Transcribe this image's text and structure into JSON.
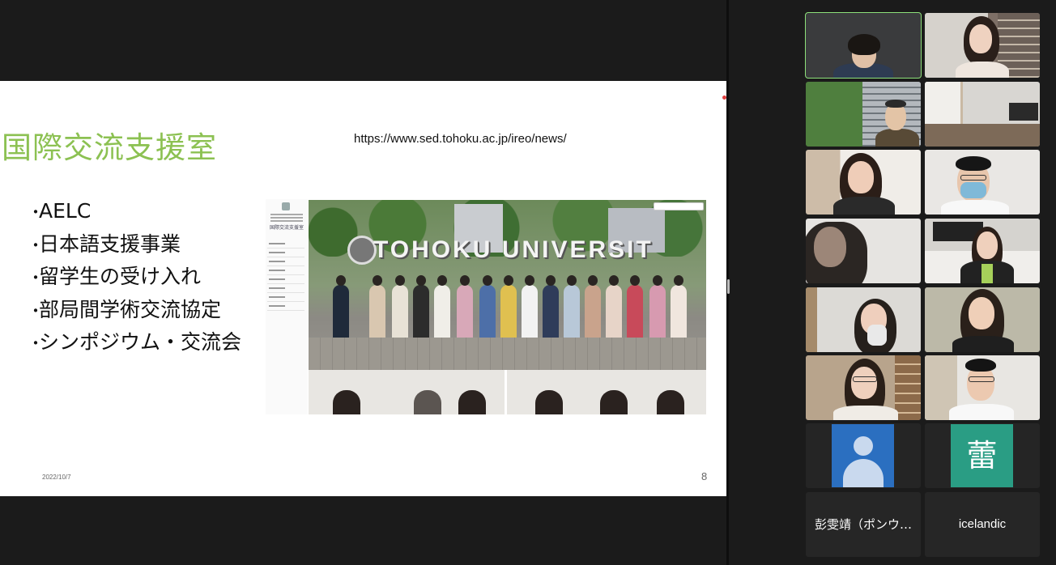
{
  "slide": {
    "title": "国際交流支援室",
    "url": "https://www.sed.tohoku.ac.jp/ireo/news/",
    "bullets": [
      "AELC",
      "日本語支援事業",
      "留学生の受け入れ",
      "部局間学術交流協定",
      "シンポジウム・交流会"
    ],
    "date": "2022/10/7",
    "page_number": "8",
    "embedded_site": {
      "sign_text": "TOHOKU UNIVERSIT",
      "sidebar_title": "国際交流支援室"
    }
  },
  "participants": {
    "video_tiles": [
      {
        "id": "p1",
        "active": true
      },
      {
        "id": "p2"
      },
      {
        "id": "p3"
      },
      {
        "id": "p4"
      },
      {
        "id": "p5"
      },
      {
        "id": "p6"
      },
      {
        "id": "p7"
      },
      {
        "id": "p8"
      },
      {
        "id": "p9"
      },
      {
        "id": "p10"
      },
      {
        "id": "p11"
      },
      {
        "id": "p12"
      }
    ],
    "avatar_tiles": [
      {
        "type": "generic-user-avatar",
        "color": "#2b6fc0"
      },
      {
        "type": "initial",
        "initial": "蕾",
        "color": "#2a9d84"
      }
    ],
    "name_tiles": [
      {
        "name": "彭雯靖（ポンウ…"
      },
      {
        "name": "icelandic"
      }
    ]
  },
  "colors": {
    "title_green": "#8cc152",
    "active_speaker_border": "#8de07a",
    "background": "#1b1b1b"
  }
}
